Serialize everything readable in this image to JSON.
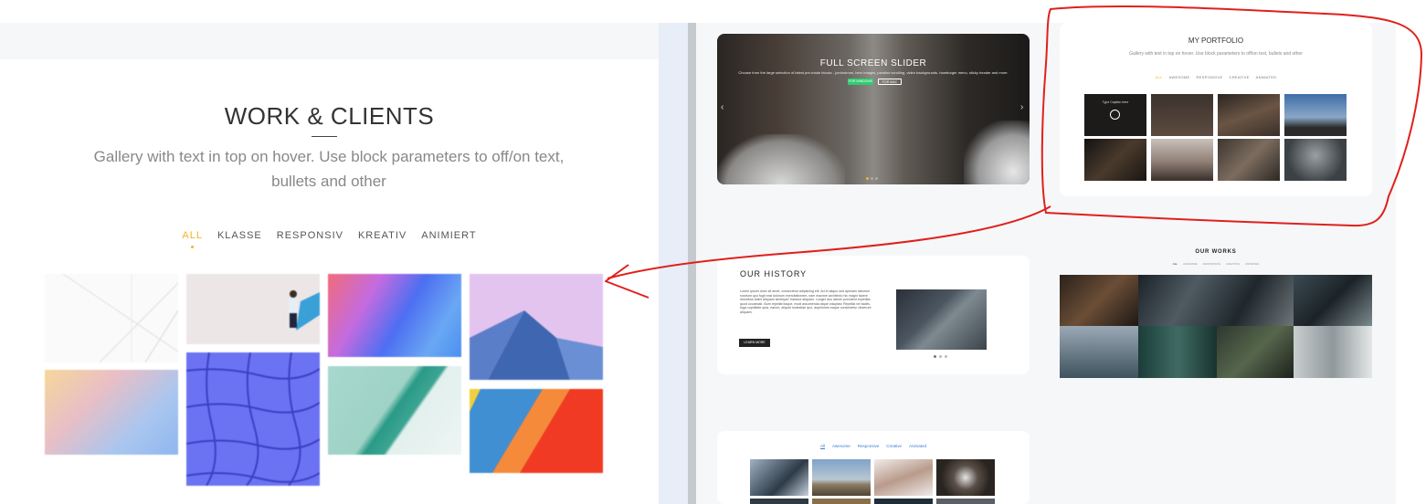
{
  "left": {
    "title": "WORK & CLIENTS",
    "subtitle": "Gallery with text in top on hover. Use block parameters to off/on text, bullets and other",
    "tabs": [
      {
        "label": "ALL",
        "active": true
      },
      {
        "label": "KLASSE",
        "active": false
      },
      {
        "label": "RESPONSIV",
        "active": false
      },
      {
        "label": "KREATIV",
        "active": false
      },
      {
        "label": "ANIMIERT",
        "active": false
      }
    ]
  },
  "slider": {
    "title": "FULL SCREEN SLIDER",
    "text": "Choose from the large selection of latest pre-made blocks - jumbotrons, hero images, parallax scrolling, video backgrounds, hamburger menu, sticky header and more.",
    "button_primary": "FOR WINDOWS",
    "button_secondary": "FOR MAC",
    "prev_arrow": "‹",
    "next_arrow": "›"
  },
  "portfolio": {
    "title": "MY PORTFOLIO",
    "subtitle": "Gallery with text in top on hover. Use block parameters to off/on text, bullets and other",
    "tabs": [
      {
        "label": "ALL",
        "active": true
      },
      {
        "label": "AWESOME",
        "active": false
      },
      {
        "label": "RESPONSIVE",
        "active": false
      },
      {
        "label": "CREATIVE",
        "active": false
      },
      {
        "label": "ANIMATED",
        "active": false
      }
    ],
    "hover_caption": "Type Caption here"
  },
  "history": {
    "title": "OUR HISTORY",
    "text": "Lorem ipsum dolor sit amet, consectetur adipiscing elit. Ad et aliquo sed aperiam laborum nostrum quo fugit erat dolorum exercitationem, nam maxime architecto hic magni facere doloribus animi aliquam similique! Incidunt aliquam. Longer duo labore provident expedita quod occaecati. Illum repellat itaque, modi assumenda atque voluptas! Repellat vel facilis, fuga cupiditate quia, earum, aliquid molestiae quo, asperiores eaque consectetur deserunt aliquam.",
    "button": "LEARN MORE"
  },
  "works": {
    "title": "OUR WORKS",
    "tabs": [
      {
        "label": "ALL",
        "active": true
      },
      {
        "label": "AWESOME",
        "active": false
      },
      {
        "label": "RESPONSIVE",
        "active": false
      },
      {
        "label": "CREATIVE",
        "active": false
      },
      {
        "label": "ANIMATED",
        "active": false
      }
    ]
  },
  "gallery": {
    "tabs": [
      {
        "label": "All",
        "active": true
      },
      {
        "label": "Awesome",
        "active": false
      },
      {
        "label": "Responsive",
        "active": false
      },
      {
        "label": "Creative",
        "active": false
      },
      {
        "label": "Animated",
        "active": false
      }
    ]
  },
  "colors": {
    "accent": "#f0b429",
    "annotation": "#e0201c",
    "gallery_link": "#3a7bd5"
  }
}
